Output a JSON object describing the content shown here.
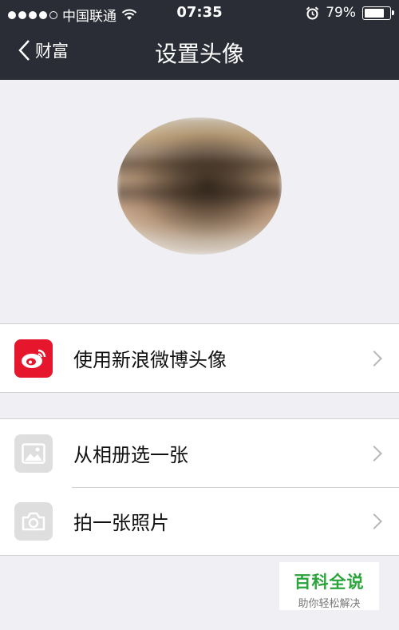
{
  "status_bar": {
    "carrier": "中国联通",
    "time": "07:35",
    "battery": "79%",
    "battery_level": 0.79,
    "icons": [
      "signal-dots-icon",
      "wifi-icon",
      "alarm-clock-icon",
      "battery-icon"
    ]
  },
  "nav": {
    "back_label": "财富",
    "title": "设置头像"
  },
  "options": [
    {
      "label": "使用新浪微博头像",
      "icon": "weibo-icon",
      "icon_color": "#e6162d"
    },
    {
      "label": "从相册选一张",
      "icon": "photo-album-icon",
      "icon_color": "#dedede"
    },
    {
      "label": "拍一张照片",
      "icon": "camera-icon",
      "icon_color": "#dedede"
    }
  ],
  "colors": {
    "navbar": "#2a2d36",
    "background": "#efeff4",
    "watermark_green": "#2aa43b"
  },
  "watermark": {
    "title": "百科全说",
    "subtitle": "助你轻松解决"
  }
}
